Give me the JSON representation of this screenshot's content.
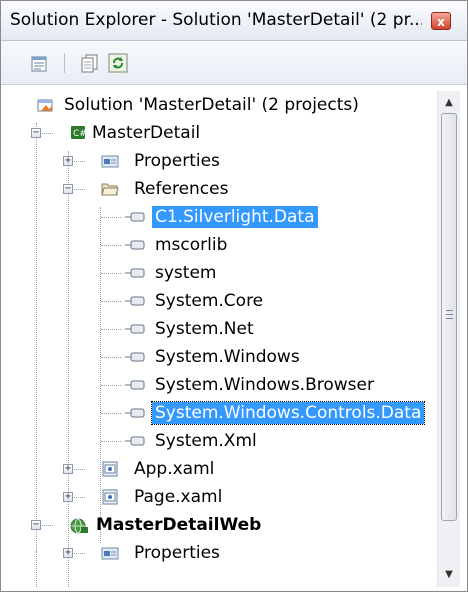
{
  "window": {
    "title": "Solution Explorer - Solution 'MasterDetail' (2 pr...",
    "close_label": "x"
  },
  "toolbar": {
    "buttons": [
      {
        "icon": "properties-icon"
      },
      {
        "icon": "show-all-files-icon"
      },
      {
        "icon": "refresh-icon"
      }
    ]
  },
  "tree": {
    "solution": "Solution 'MasterDetail' (2 projects)",
    "project1": {
      "name": "MasterDetail",
      "properties": "Properties",
      "references": "References",
      "refs": [
        "C1.Silverlight.Data",
        "mscorlib",
        "system",
        "System.Core",
        "System.Net",
        "System.Windows",
        "System.Windows.Browser",
        "System.Windows.Controls.Data",
        "System.Xml"
      ],
      "app_xaml": "App.xaml",
      "page_xaml": "Page.xaml"
    },
    "project2": {
      "name": "MasterDetailWeb",
      "properties": "Properties"
    }
  },
  "colors": {
    "selection": "#3399ff",
    "title_bg": "#e3e9f3"
  }
}
